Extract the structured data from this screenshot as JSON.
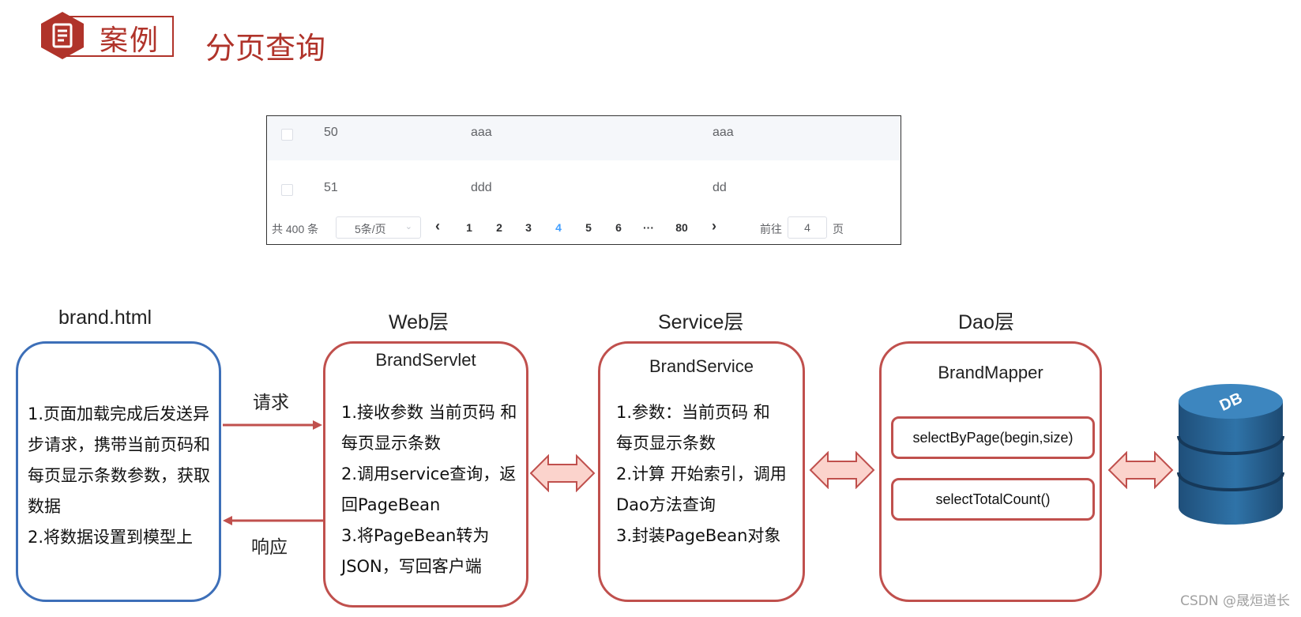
{
  "header": {
    "badge_label": "案例",
    "title": "分页查询",
    "badge_icon": "document-icon",
    "accent_color": "#b0332a"
  },
  "table_widget": {
    "rows": [
      {
        "id": "50",
        "col2": "aaa",
        "col3": "aaa"
      },
      {
        "id": "51",
        "col2": "ddd",
        "col3": "dd"
      }
    ],
    "pagination": {
      "total": "共 400 条",
      "page_size": "5条/页",
      "prev": "‹",
      "pages": [
        "1",
        "2",
        "3",
        "4",
        "5",
        "6",
        "···",
        "80"
      ],
      "active_page": "4",
      "next": "›",
      "goto_label": "前往",
      "goto_value": "4",
      "goto_unit": "页"
    }
  },
  "layers": {
    "client": {
      "title": "brand.html",
      "lines": [
        "1.页面加载完成后发送异",
        "步请求，携带当前页码和",
        "每页显示条数参数，获取",
        "数据",
        "2.将数据设置到模型上"
      ]
    },
    "web": {
      "title": "Web层",
      "box_title": "BrandServlet",
      "lines": [
        "1.接收参数 当前页码 和",
        "每页显示条数",
        "2.调用service查询，返",
        "回PageBean",
        "3.将PageBean转为",
        "JSON，写回客户端"
      ]
    },
    "service": {
      "title": "Service层",
      "box_title": "BrandService",
      "lines": [
        "1.参数：当前页码 和",
        "每页显示条数",
        "2.计算 开始索引，调用",
        "Dao方法查询",
        "3.封装PageBean对象"
      ]
    },
    "dao": {
      "title": "Dao层",
      "box_title": "BrandMapper",
      "methods": [
        "selectByPage(begin,size)",
        "selectTotalCount()"
      ]
    },
    "db_label": "DB"
  },
  "arrows": {
    "request_label": "请求",
    "response_label": "响应"
  },
  "watermark": "CSDN @晟烜道长"
}
